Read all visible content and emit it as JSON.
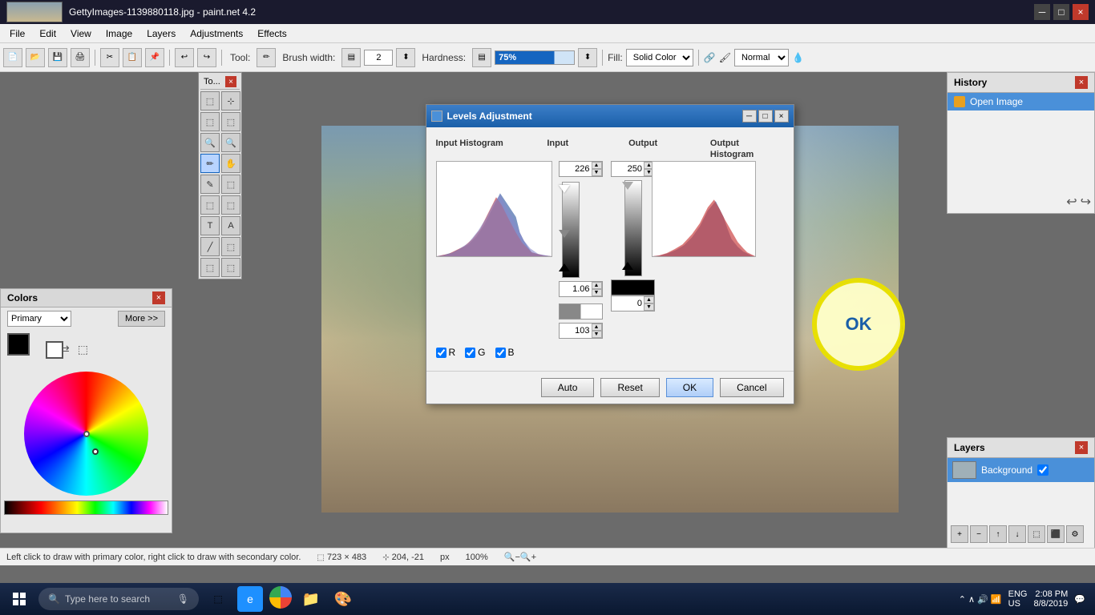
{
  "window": {
    "title": "GettyImages-1139880118.jpg - paint.net 4.2",
    "minimize": "─",
    "maximize": "□",
    "close": "×"
  },
  "menu": {
    "items": [
      "File",
      "Edit",
      "View",
      "Image",
      "Layers",
      "Adjustments",
      "Effects"
    ]
  },
  "toolbar": {
    "tool_label": "Tool:",
    "brush_width_label": "Brush width:",
    "brush_width_value": "2",
    "hardness_label": "Hardness:",
    "hardness_value": "75%",
    "fill_label": "Fill:",
    "fill_value": "Solid Color",
    "blend_label": "Normal",
    "add_layer_btn": "+"
  },
  "tools_panel": {
    "title": "To...",
    "tools": [
      "↖",
      "⊹",
      "⬚",
      "⬚",
      "🔍",
      "🔍",
      "✏",
      "✋",
      "✏",
      "⬚",
      "⬚",
      "⬚",
      "✒",
      "⬚",
      "✎",
      "⬚",
      "T",
      "A",
      "⬚",
      "⬚"
    ]
  },
  "dialog": {
    "title": "Levels Adjustment",
    "minimize": "─",
    "maximize": "□",
    "close": "×",
    "input_histogram_label": "Input Histogram",
    "input_label": "Input",
    "output_label": "Output",
    "output_histogram_label": "Output Histogram",
    "input_top_value": "226",
    "input_mid_value": "1.06",
    "input_bot_value": "103",
    "output_top_value": "250",
    "output_bot_value": "0",
    "channel_r": "R",
    "channel_g": "G",
    "channel_b": "B",
    "auto_btn": "Auto",
    "reset_btn": "Reset",
    "ok_btn": "OK",
    "cancel_btn": "Cancel",
    "callout_text": "OK"
  },
  "history_panel": {
    "title": "History",
    "item": "Open Image"
  },
  "layers_panel": {
    "title": "Layers",
    "layer_name": "Background"
  },
  "colors_panel": {
    "title": "Colors",
    "mode": "Primary",
    "more_btn": "More >>"
  },
  "status_bar": {
    "tip": "Left click to draw with primary color, right click to draw with secondary color.",
    "dimensions": "723 × 483",
    "coords": "204, -21",
    "unit": "px",
    "zoom": "100%"
  },
  "taskbar": {
    "search_placeholder": "Type here to search",
    "lang": "ENG",
    "region": "US",
    "time": "2:08 PM",
    "date": "8/8/2019"
  }
}
